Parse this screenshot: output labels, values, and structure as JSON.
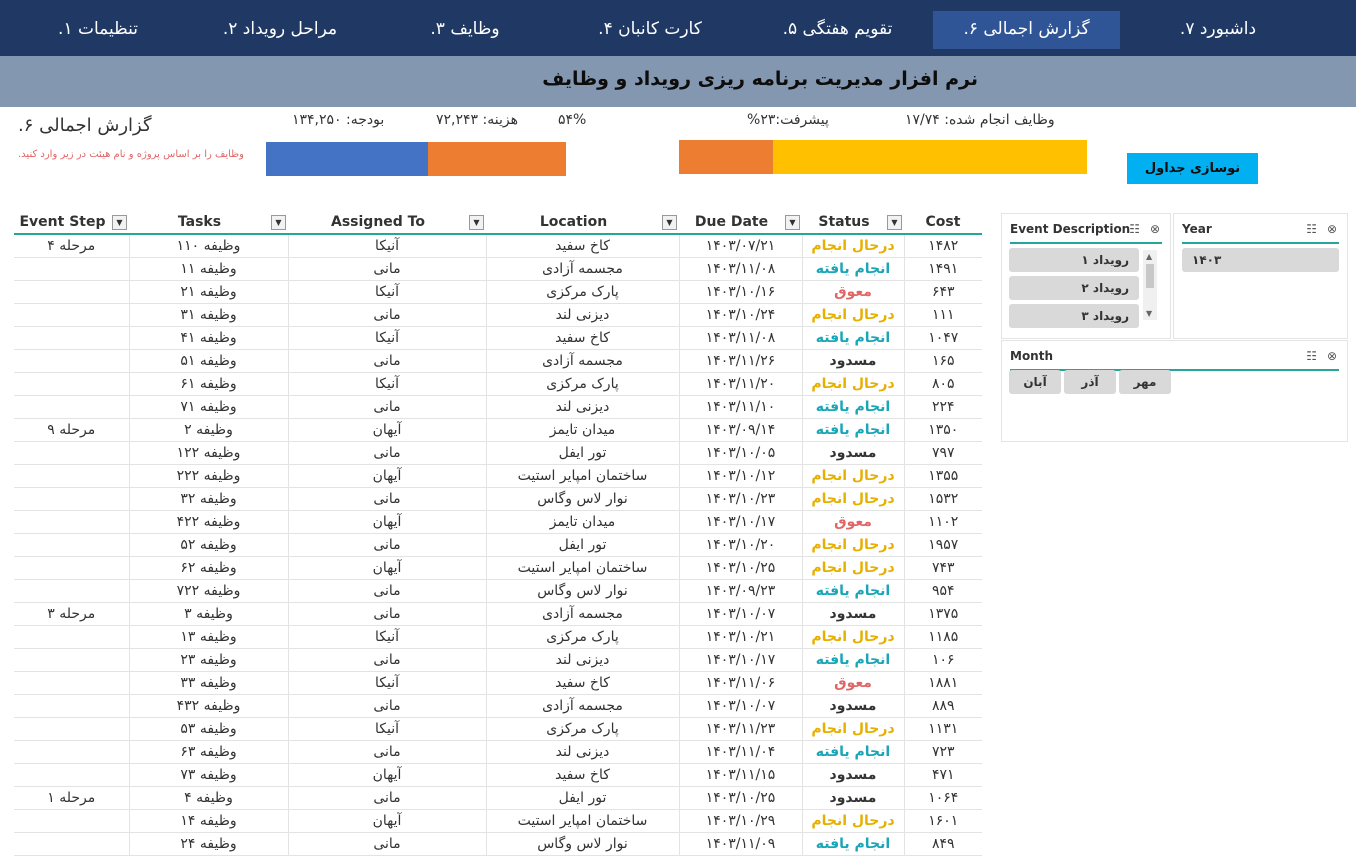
{
  "nav": {
    "items": [
      "تنظیمات ۱.",
      "مراحل رویداد ۲.",
      "وظایف ۳.",
      "کارت کانبان ۴.",
      "تقویم هفتگی ۵.",
      "گزارش اجمالی ۶.",
      "داشبورد ۷."
    ],
    "active_index": 5
  },
  "header": {
    "title": "نرم افزار مدیریت برنامه ریزی رویداد و وظایف"
  },
  "report": {
    "title": "گزارش اجمالی ۶.",
    "note": "وظایف را بر اساس پروژه و نام هیئت در زیر وارد کنید."
  },
  "kpis": {
    "budget": "بودجه: ۱۳۴,۲۵۰",
    "cost": "هزینه:   ۷۲,۲۴۳",
    "cost_pct": "۵۴%",
    "progress": "پیشرفت:۲۳%",
    "tasks_done": "وظایف انجام شده: ۱۷/۷۴"
  },
  "budget_bar": {
    "fill_fraction": 0.54,
    "fill_color": "#4472c4",
    "rest_color": "#ed7d31"
  },
  "progress_bar": {
    "fill_fraction": 0.23,
    "fill_color": "#ed7d31",
    "rest_color": "#ffc000"
  },
  "refresh_button": {
    "label": "نوسازی جداول"
  },
  "table": {
    "columns": [
      "Event Step",
      "Tasks",
      "Assigned To",
      "Location",
      "Due Date",
      "Status",
      "Cost"
    ],
    "rows": [
      [
        "مرحله ۴",
        "وظیفه ۱۱۰",
        "آنیکا",
        "کاخ سفید",
        "۱۴۰۳/۰۷/۲۱",
        "درحال انجام",
        "۱۴۸۲"
      ],
      [
        "",
        "وظیفه ۱۱",
        "مانی",
        "مجسمه آزادی",
        "۱۴۰۳/۱۱/۰۸",
        "انجام یافته",
        "۱۴۹۱"
      ],
      [
        "",
        "وظیفه ۲۱",
        "آنیکا",
        "پارک مرکزی",
        "۱۴۰۳/۱۰/۱۶",
        "معوق",
        "۶۴۳"
      ],
      [
        "",
        "وظیفه ۳۱",
        "مانی",
        "دیزنی لند",
        "۱۴۰۳/۱۰/۲۴",
        "درحال انجام",
        "۱۱۱"
      ],
      [
        "",
        "وظیفه ۴۱",
        "آنیکا",
        "کاخ سفید",
        "۱۴۰۳/۱۱/۰۸",
        "انجام یافته",
        "۱۰۴۷"
      ],
      [
        "",
        "وظیفه ۵۱",
        "مانی",
        "مجسمه آزادی",
        "۱۴۰۳/۱۱/۲۶",
        "مسدود",
        "۱۶۵"
      ],
      [
        "",
        "وظیفه ۶۱",
        "آنیکا",
        "پارک مرکزی",
        "۱۴۰۳/۱۱/۲۰",
        "درحال انجام",
        "۸۰۵"
      ],
      [
        "",
        "وظیفه ۷۱",
        "مانی",
        "دیزنی لند",
        "۱۴۰۳/۱۱/۱۰",
        "انجام یافته",
        "۲۲۴"
      ],
      [
        "مرحله ۹",
        "وظیفه ۲",
        "آیهان",
        "میدان تایمز",
        "۱۴۰۳/۰۹/۱۴",
        "انجام یافته",
        "۱۳۵۰"
      ],
      [
        "",
        "وظیفه ۱۲۲",
        "مانی",
        "تور ایفل",
        "۱۴۰۳/۱۰/۰۵",
        "مسدود",
        "۷۹۷"
      ],
      [
        "",
        "وظیفه ۲۲۲",
        "آیهان",
        "ساختمان امپایر استیت",
        "۱۴۰۳/۱۰/۱۲",
        "درحال انجام",
        "۱۳۵۵"
      ],
      [
        "",
        "وظیفه ۳۲",
        "مانی",
        "نوار لاس وگاس",
        "۱۴۰۳/۱۰/۲۳",
        "درحال انجام",
        "۱۵۳۲"
      ],
      [
        "",
        "وظیفه ۴۲۲",
        "آیهان",
        "میدان تایمز",
        "۱۴۰۳/۱۰/۱۷",
        "معوق",
        "۱۱۰۲"
      ],
      [
        "",
        "وظیفه ۵۲",
        "مانی",
        "تور ایفل",
        "۱۴۰۳/۱۰/۲۰",
        "درحال انجام",
        "۱۹۵۷"
      ],
      [
        "",
        "وظیفه ۶۲",
        "آیهان",
        "ساختمان امپایر استیت",
        "۱۴۰۳/۱۰/۲۵",
        "درحال انجام",
        "۷۴۳"
      ],
      [
        "",
        "وظیفه ۷۲۲",
        "مانی",
        "نوار لاس وگاس",
        "۱۴۰۳/۰۹/۲۳",
        "انجام یافته",
        "۹۵۴"
      ],
      [
        "مرحله ۳",
        "وظیفه ۳",
        "مانی",
        "مجسمه آزادی",
        "۱۴۰۳/۱۰/۰۷",
        "مسدود",
        "۱۳۷۵"
      ],
      [
        "",
        "وظیفه ۱۳",
        "آنیکا",
        "پارک مرکزی",
        "۱۴۰۳/۱۰/۲۱",
        "درحال انجام",
        "۱۱۸۵"
      ],
      [
        "",
        "وظیفه ۲۳",
        "مانی",
        "دیزنی لند",
        "۱۴۰۳/۱۰/۱۷",
        "انجام یافته",
        "۱۰۶"
      ],
      [
        "",
        "وظیفه ۳۳",
        "آنیکا",
        "کاخ سفید",
        "۱۴۰۳/۱۱/۰۶",
        "معوق",
        "۱۸۸۱"
      ],
      [
        "",
        "وظیفه ۴۳۲",
        "مانی",
        "مجسمه آزادی",
        "۱۴۰۳/۱۰/۰۷",
        "مسدود",
        "۸۸۹"
      ],
      [
        "",
        "وظیفه ۵۳",
        "آنیکا",
        "پارک مرکزی",
        "۱۴۰۳/۱۱/۲۳",
        "درحال انجام",
        "۱۱۳۱"
      ],
      [
        "",
        "وظیفه ۶۳",
        "مانی",
        "دیزنی لند",
        "۱۴۰۳/۱۱/۰۴",
        "انجام یافته",
        "۷۲۳"
      ],
      [
        "",
        "وظیفه ۷۳",
        "آیهان",
        "کاخ سفید",
        "۱۴۰۳/۱۱/۱۵",
        "مسدود",
        "۴۷۱"
      ],
      [
        "مرحله ۱",
        "وظیفه ۴",
        "مانی",
        "تور ایفل",
        "۱۴۰۳/۱۰/۲۵",
        "مسدود",
        "۱۰۶۴"
      ],
      [
        "",
        "وظیفه ۱۴",
        "آیهان",
        "ساختمان امپایر استیت",
        "۱۴۰۳/۱۰/۲۹",
        "درحال انجام",
        "۱۶۰۱"
      ],
      [
        "",
        "وظیفه ۲۴",
        "مانی",
        "نوار لاس وگاس",
        "۱۴۰۳/۱۱/۰۹",
        "انجام یافته",
        "۸۴۹"
      ]
    ]
  },
  "status_colors": {
    "درحال انجام": "#e6b000",
    "انجام یافته": "#1aa6b7",
    "معوق": "#e06666",
    "مسدود": "#333333"
  },
  "slicers": {
    "event": {
      "title": "Event Description",
      "items": [
        "رویداد ۱",
        "رویداد ۲",
        "رویداد ۳"
      ]
    },
    "year": {
      "title": "Year",
      "items": [
        "۱۴۰۳"
      ]
    },
    "month": {
      "title": "Month",
      "items": [
        "مهر",
        "آذر",
        "آبان"
      ]
    }
  },
  "icons": {
    "multi_select": "multi-select-icon",
    "clear_filter": "clear-filter-icon",
    "dropdown": "dropdown-arrow-icon"
  }
}
